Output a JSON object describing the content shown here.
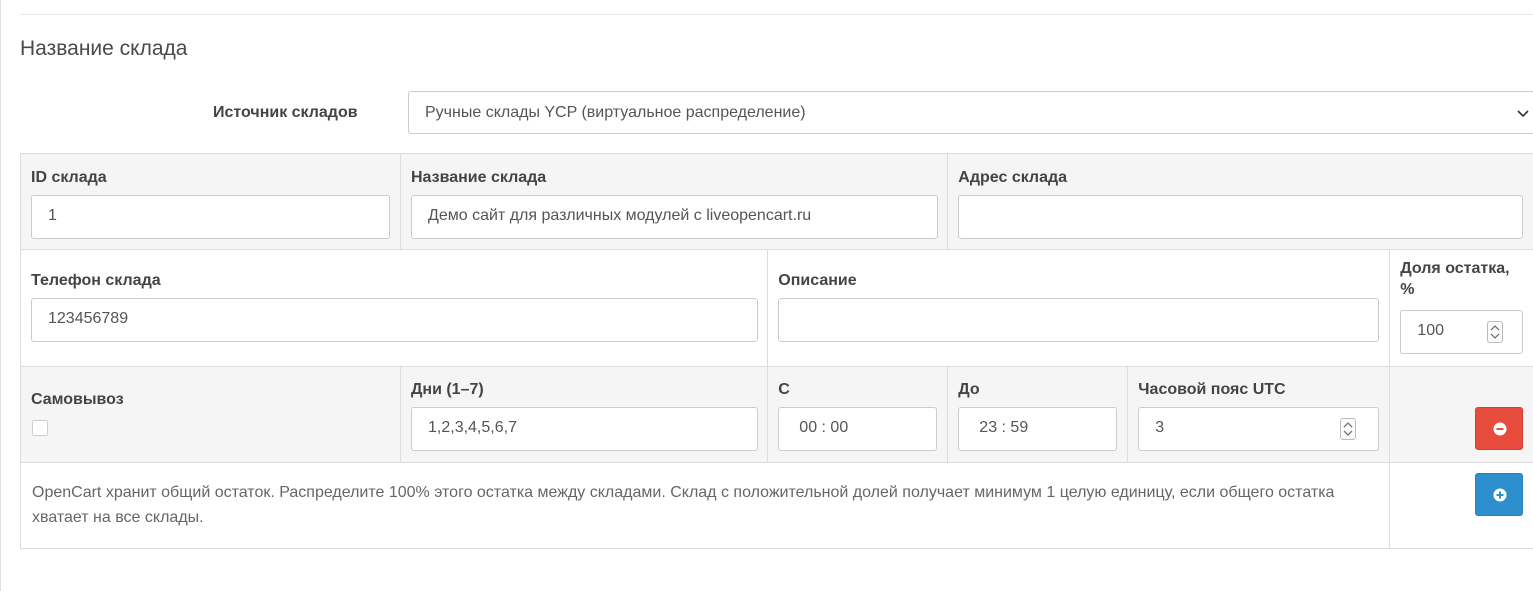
{
  "section": {
    "title": "Название склада"
  },
  "source": {
    "label": "Источник складов",
    "selected": "Ручные склады YCP (виртуальное распределение)"
  },
  "row1": {
    "id_label": "ID склада",
    "id_value": "1",
    "name_label": "Название склада",
    "name_value": "Демо сайт для различных модулей с liveopencart.ru",
    "address_label": "Адрес склада",
    "address_value": ""
  },
  "row2": {
    "phone_label": "Телефон склада",
    "phone_value": "123456789",
    "desc_label": "Описание",
    "desc_value": "",
    "share_label": "Доля остатка, %",
    "share_value": "100"
  },
  "row3": {
    "pickup_label": "Самовывоз",
    "pickup_checked": false,
    "days_label": "Дни (1–7)",
    "days_value": "1,2,3,4,5,6,7",
    "from_label": "С",
    "from_value": "00 : 00",
    "to_label": "До",
    "to_value": "23 : 59",
    "tz_label": "Часовой пояс UTC",
    "tz_value": "3"
  },
  "note": "OpenCart хранит общий остаток. Распределите 100% этого остатка между складами. Склад с положительной долей получает минимум 1 целую единицу, если общего остатка хватает на все склады.",
  "icons": {
    "select_chevron": "chevron-down-icon",
    "remove": "minus-circle-icon",
    "add": "plus-circle-icon",
    "spinner": "spinner-arrows-icon"
  },
  "colors": {
    "remove_button": "#e74c3c",
    "add_button": "#2e8fcf",
    "row_shade": "#f5f5f5",
    "border": "#dcdcdc"
  }
}
